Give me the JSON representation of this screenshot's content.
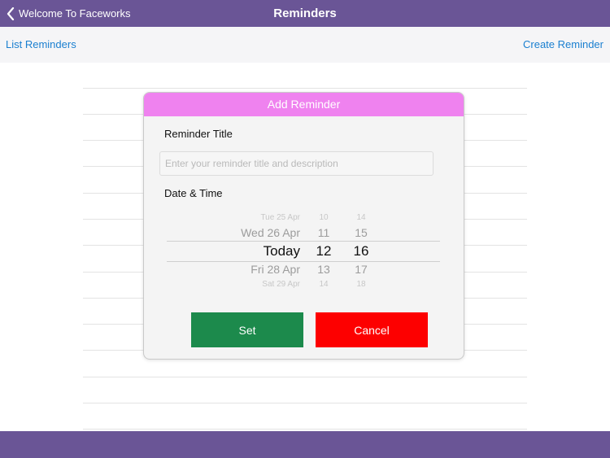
{
  "navbar": {
    "back_label": "Welcome To Faceworks",
    "title": "Reminders",
    "color": "#6a5596"
  },
  "toolbar": {
    "left_link": "List Reminders",
    "right_link": "Create Reminder",
    "link_color": "#1a7fd0"
  },
  "dialog": {
    "title": "Add Reminder",
    "header_color": "#ef82ef",
    "reminder_title_label": "Reminder Title",
    "title_input": {
      "value": "",
      "placeholder": "Enter your reminder title and description"
    },
    "date_time_label": "Date & Time",
    "picker": {
      "day": [
        "Tue 25 Apr",
        "Wed 26 Apr",
        "Today",
        "Fri 28 Apr",
        "Sat 29 Apr"
      ],
      "hour": [
        "10",
        "11",
        "12",
        "13",
        "14"
      ],
      "minute": [
        "14",
        "15",
        "16",
        "17",
        "18"
      ],
      "selected": {
        "day": "Today",
        "hour": "12",
        "minute": "16"
      }
    },
    "set_label": "Set",
    "set_color": "#1c8a4c",
    "cancel_label": "Cancel",
    "cancel_color": "#fd0000"
  },
  "icons": {
    "back": "chevron-left-icon"
  }
}
